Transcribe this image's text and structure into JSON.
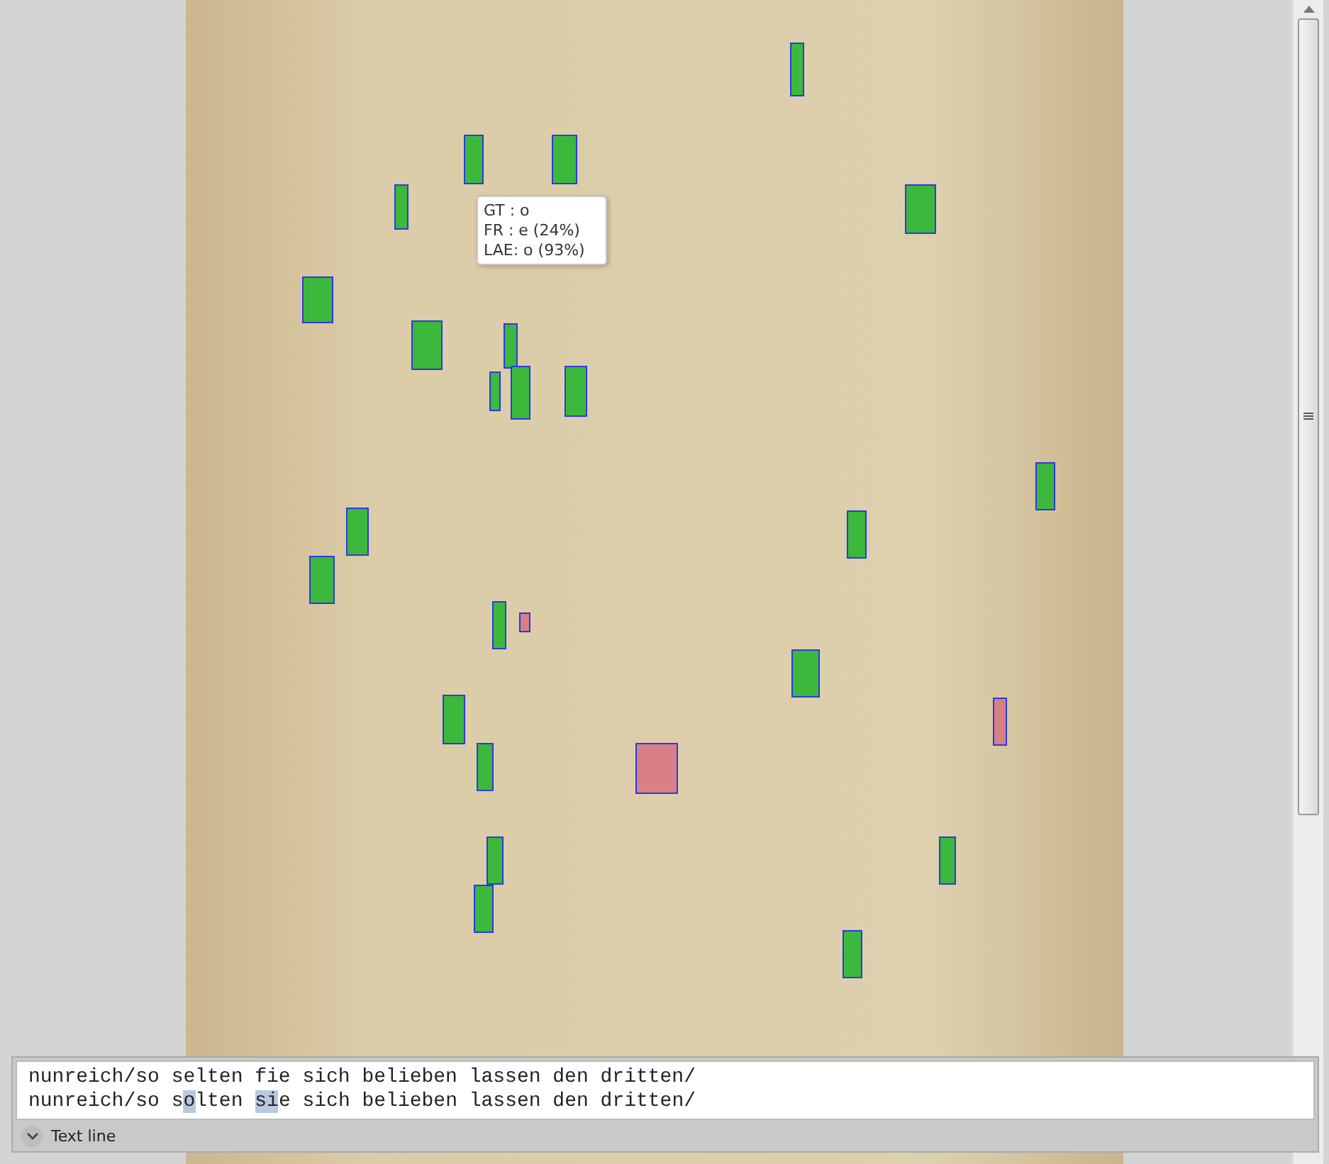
{
  "tooltip": {
    "lines": [
      "GT : o",
      "FR : e (24%)",
      "LAE: o (93%)"
    ]
  },
  "marks": [
    {
      "color": "#3cb83c"
    },
    {
      "color": "#3cb83c"
    },
    {
      "color": "#3cb83c"
    },
    {
      "color": "#3cb83c"
    },
    {
      "color": "#3cb83c"
    },
    {
      "color": "#3cb83c"
    },
    {
      "color": "#3cb83c"
    },
    {
      "color": "#3cb83c"
    },
    {
      "color": "#3cb83c"
    },
    {
      "color": "#3cb83c"
    },
    {
      "color": "#3cb83c"
    },
    {
      "color": "#3cb83c"
    },
    {
      "color": "#3cb83c"
    },
    {
      "color": "#3cb83c"
    },
    {
      "color": "#3cb83c"
    },
    {
      "color": "#3cb83c"
    },
    {
      "color": "#d97f86"
    },
    {
      "color": "#3cb83c"
    },
    {
      "color": "#3cb83c"
    },
    {
      "color": "#d97f86"
    },
    {
      "color": "#d97f86"
    },
    {
      "color": "#3cb83c"
    },
    {
      "color": "#3cb83c"
    },
    {
      "color": "#3cb83c"
    },
    {
      "color": "#3cb83c"
    },
    {
      "color": "#3cb83c"
    }
  ],
  "text_panel": {
    "label": "Text line",
    "expanded": true,
    "lines": [
      [
        {
          "text": "nunreich/so selten fie sich belieben lassen den dritten/",
          "changed": false
        }
      ],
      [
        {
          "text": "nunreich/so s",
          "changed": false
        },
        {
          "text": "o",
          "changed": true
        },
        {
          "text": "lten ",
          "changed": false
        },
        {
          "text": "si",
          "changed": true
        },
        {
          "text": "e sich belieben lassen den dritten/",
          "changed": false
        }
      ]
    ]
  }
}
